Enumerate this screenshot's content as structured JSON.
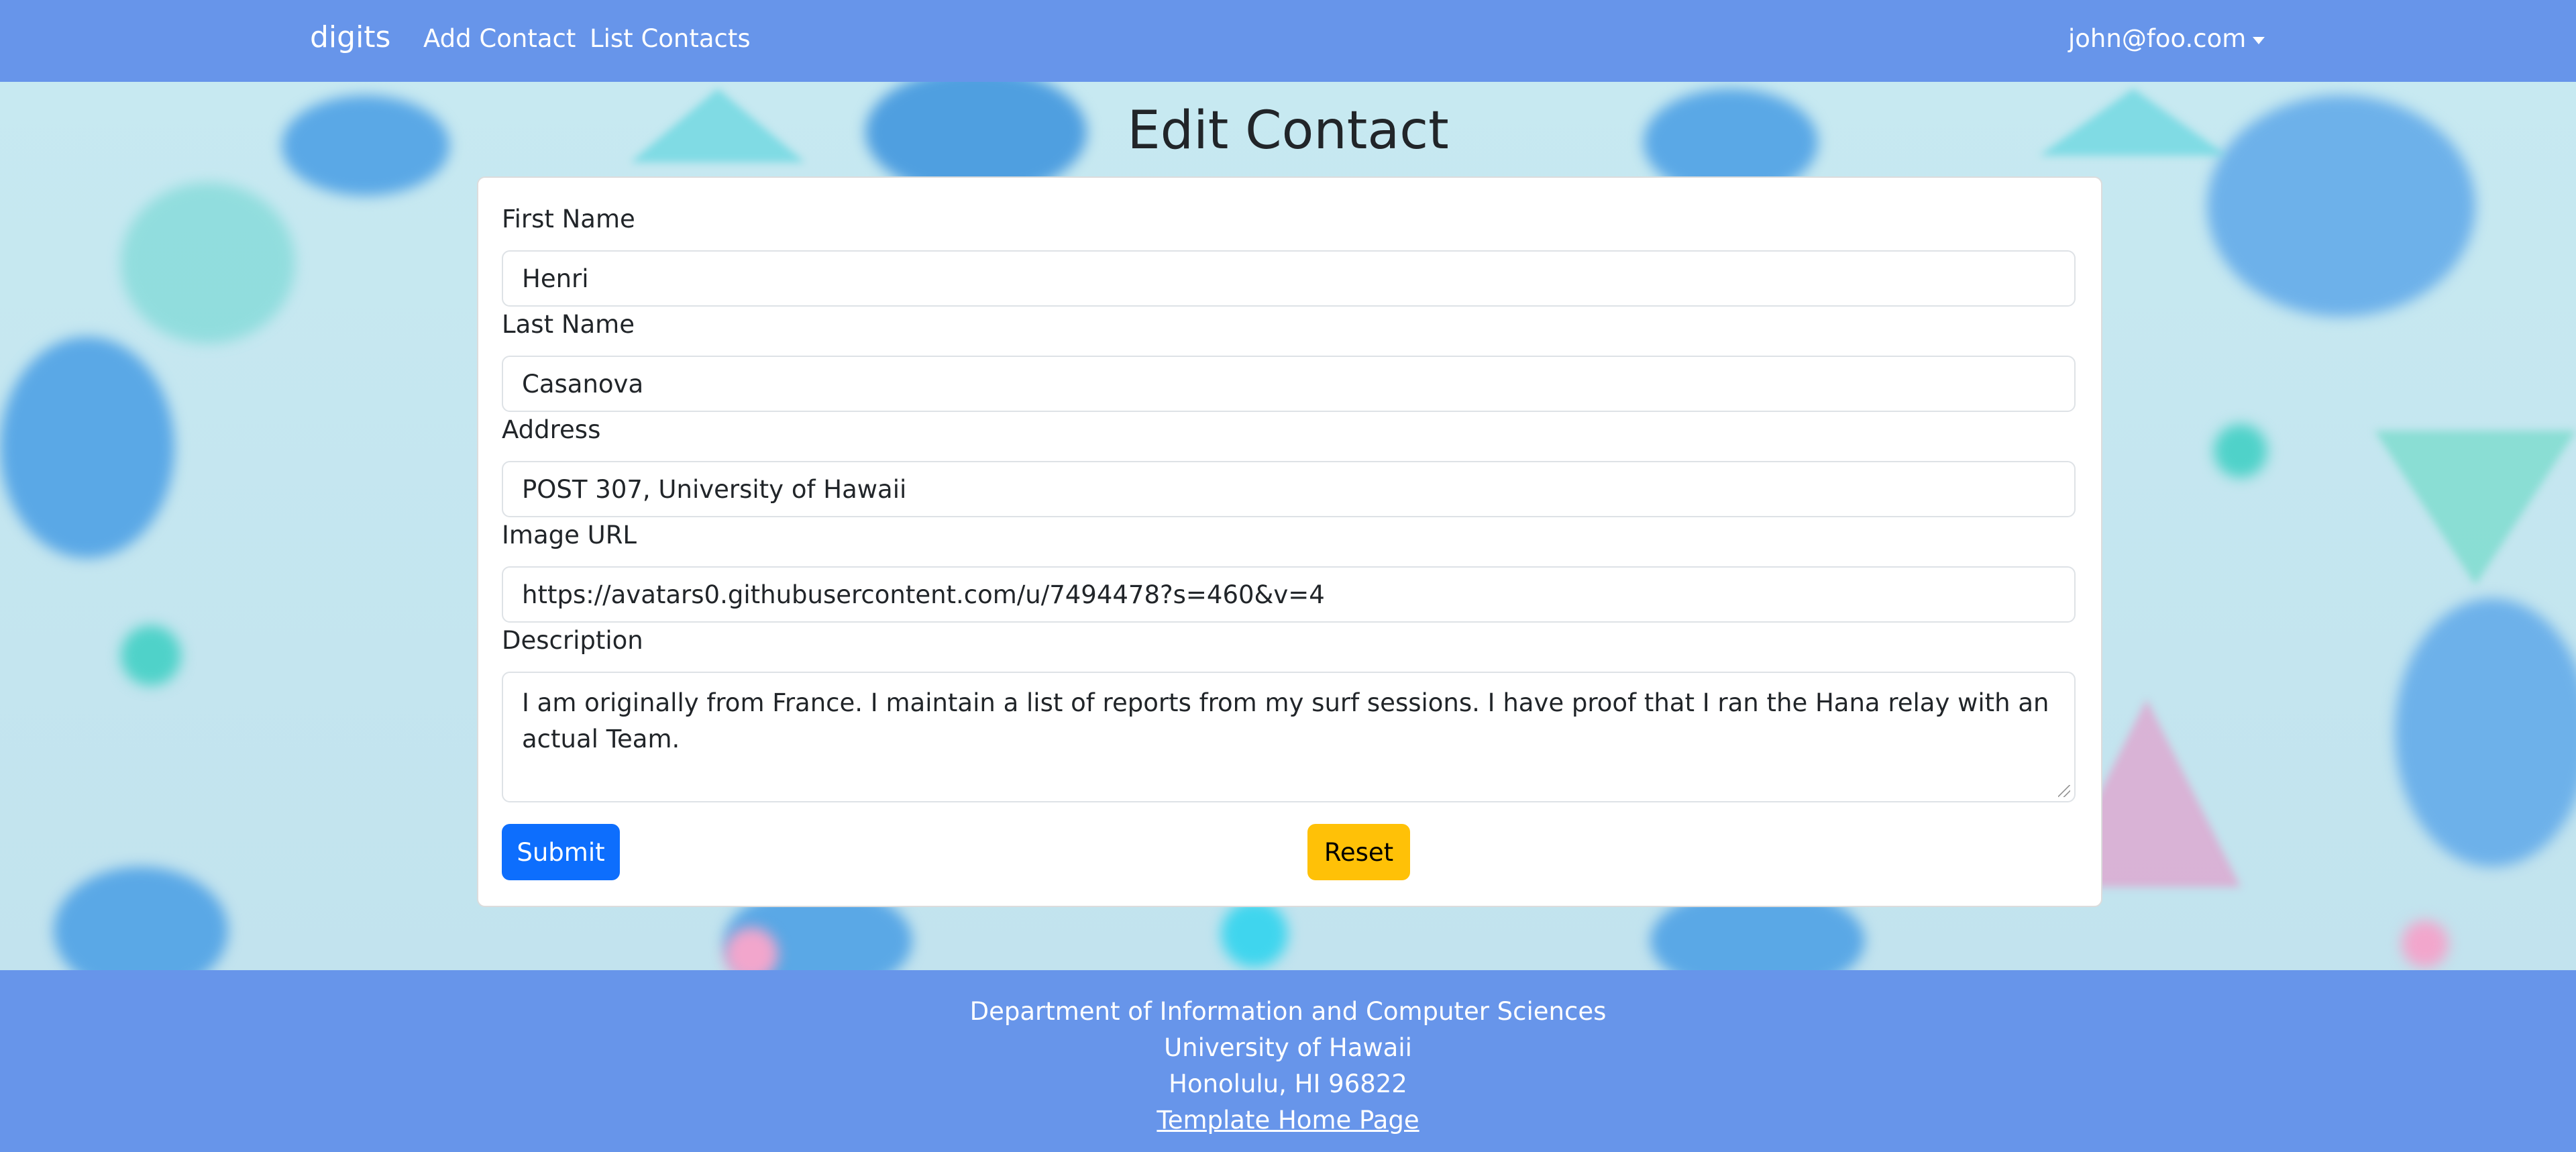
{
  "navbar": {
    "brand": "digits",
    "links": [
      {
        "label": "Add Contact"
      },
      {
        "label": "List Contacts"
      }
    ],
    "user": "john@foo.com"
  },
  "page": {
    "title": "Edit Contact"
  },
  "form": {
    "first_name": {
      "label": "First Name",
      "value": "Henri"
    },
    "last_name": {
      "label": "Last Name",
      "value": "Casanova"
    },
    "address": {
      "label": "Address",
      "value": "POST 307, University of Hawaii"
    },
    "image_url": {
      "label": "Image URL",
      "value": "https://avatars0.githubusercontent.com/u/7494478?s=460&v=4"
    },
    "description": {
      "label": "Description",
      "value": "I am originally from France. I maintain a list of reports from my surf sessions. I have proof that I ran the Hana relay with an actual Team."
    },
    "submit_label": "Submit",
    "reset_label": "Reset"
  },
  "footer": {
    "line1": "Department of Information and Computer Sciences",
    "line2": "University of Hawaii",
    "line3": "Honolulu, HI 96822",
    "link": "Template Home Page"
  },
  "colors": {
    "navbar": "#6795ea",
    "submit": "#0d6efd",
    "reset": "#ffc107"
  }
}
